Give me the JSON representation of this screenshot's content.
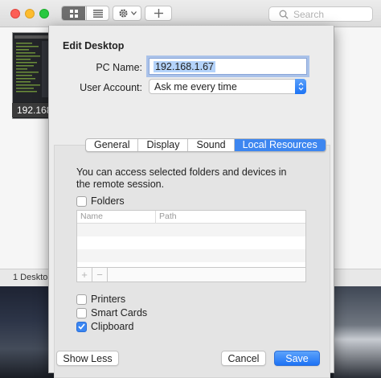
{
  "app": {
    "search_placeholder": "Search",
    "thumbnail_label": "192.168.1.67",
    "status_text": "1 Desktop"
  },
  "sheet": {
    "title": "Edit Desktop",
    "pc_name_label": "PC Name:",
    "pc_name_value": "192.168.1.67",
    "user_account_label": "User Account:",
    "user_account_value": "Ask me every time",
    "tabs": [
      {
        "label": "General"
      },
      {
        "label": "Display"
      },
      {
        "label": "Sound"
      },
      {
        "label": "Local Resources"
      }
    ],
    "active_tab": "Local Resources",
    "local_resources": {
      "description": "You can access selected folders and devices in the remote session.",
      "folders_label": "Folders",
      "folders_checked": false,
      "table_columns": [
        "Name",
        "Path"
      ],
      "add_symbol": "+",
      "remove_symbol": "−",
      "printers_label": "Printers",
      "printers_checked": false,
      "smartcards_label": "Smart Cards",
      "smartcards_checked": false,
      "clipboard_label": "Clipboard",
      "clipboard_checked": true
    },
    "buttons": {
      "show_less": "Show Less",
      "cancel": "Cancel",
      "save": "Save"
    }
  },
  "icons": {
    "grid_view": "grid-view-icon",
    "list_view": "list-view-icon",
    "gear": "gear-icon",
    "add": "plus-icon",
    "search": "search-icon"
  },
  "colors": {
    "accent": "#3d86f0",
    "close": "#fc5f57",
    "minimize": "#fdbc2e",
    "zoom": "#28c840"
  }
}
